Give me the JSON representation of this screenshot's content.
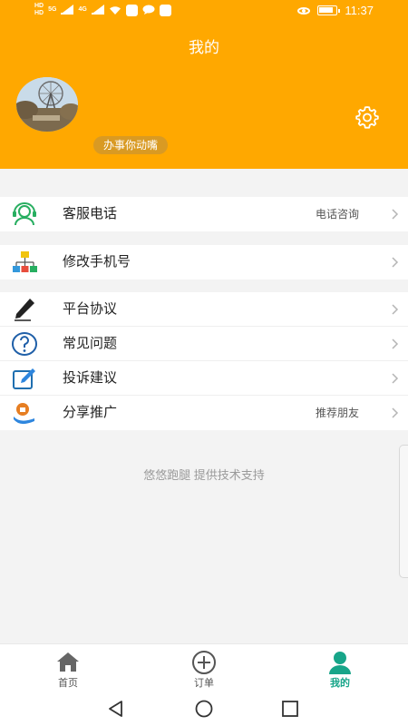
{
  "status_bar": {
    "left_indicators": [
      "HD",
      "HD",
      "5G",
      "4G"
    ],
    "time": "11:37"
  },
  "header": {
    "title": "我的",
    "nickname": "办事你动嘴"
  },
  "menu": {
    "group1": [
      {
        "label": "客服电话",
        "hint": "电话咨询",
        "icon": "customer-service-icon"
      }
    ],
    "group2": [
      {
        "label": "修改手机号",
        "hint": "",
        "icon": "org-chart-icon"
      }
    ],
    "group3": [
      {
        "label": "平台协议",
        "hint": "",
        "icon": "pen-icon"
      },
      {
        "label": "常见问题",
        "hint": "",
        "icon": "question-icon"
      },
      {
        "label": "投诉建议",
        "hint": "",
        "icon": "edit-icon"
      },
      {
        "label": "分享推广",
        "hint": "推荐朋友",
        "icon": "share-gift-icon"
      }
    ]
  },
  "footer_text": "悠悠跑腿 提供技术支持",
  "tabs": [
    {
      "label": "首页",
      "icon": "home-icon",
      "active": false
    },
    {
      "label": "订单",
      "icon": "plus-circle-icon",
      "active": false
    },
    {
      "label": "我的",
      "icon": "person-icon",
      "active": true
    }
  ],
  "colors": {
    "header_bg": "#ffa800",
    "nickname_bg": "#d99a23",
    "tab_active": "#17a589",
    "page_bg": "#f3f3f3"
  }
}
